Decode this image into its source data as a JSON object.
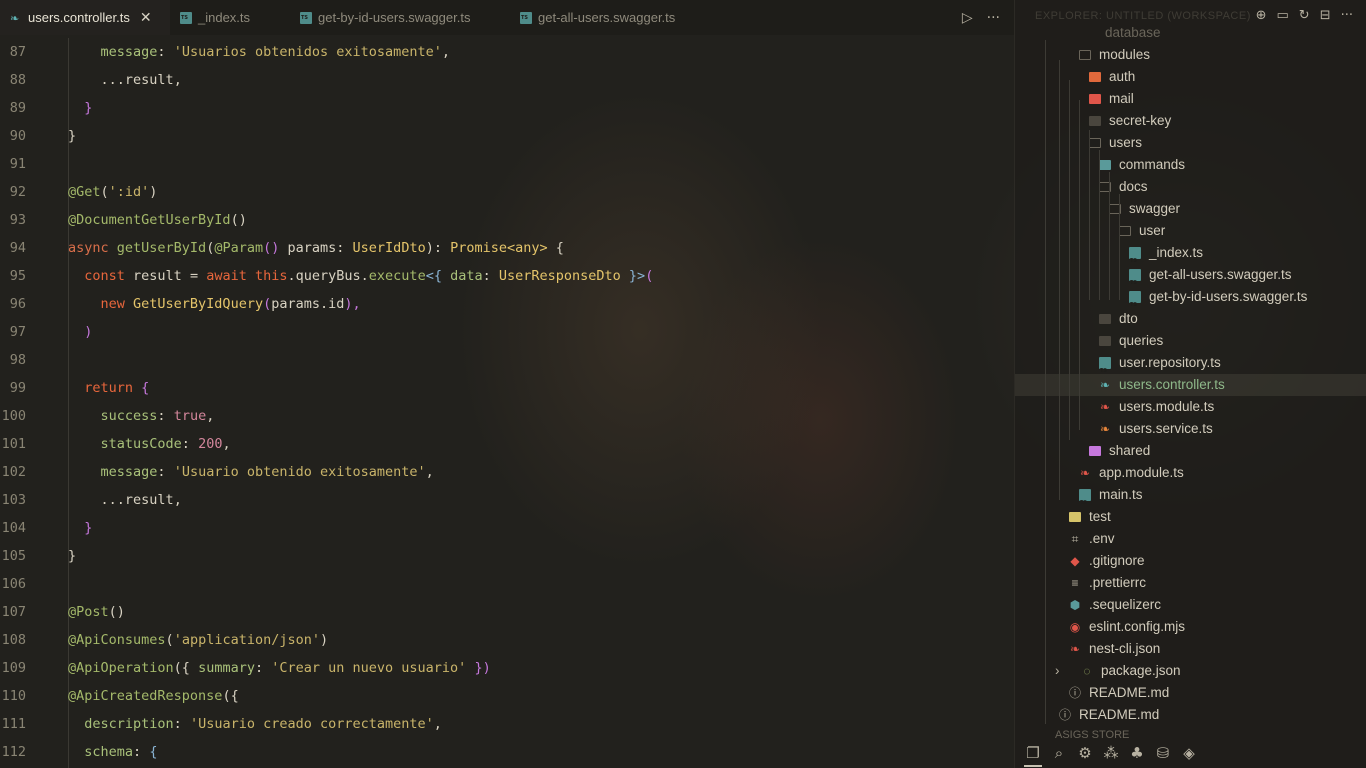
{
  "tabs": [
    {
      "label": "users.controller.ts",
      "icon": "nestjs-icon",
      "active": true
    },
    {
      "label": "_index.ts",
      "icon": "typescript-icon",
      "active": false
    },
    {
      "label": "get-by-id-users.swagger.ts",
      "icon": "typescript-icon",
      "active": false
    },
    {
      "label": "get-all-users.swagger.ts",
      "icon": "typescript-icon",
      "active": false
    }
  ],
  "tab_actions": {
    "run_icon": "▷",
    "more_icon": "···"
  },
  "code_lines": [
    {
      "n": "87",
      "tokens": [
        [
          "    ",
          "t-plain"
        ],
        [
          "message",
          "t-prop"
        ],
        [
          ": ",
          "t-plain"
        ],
        [
          "'Usuarios obtenidos exitosamente'",
          "t-str"
        ],
        [
          ",",
          "t-plain"
        ]
      ]
    },
    {
      "n": "88",
      "tokens": [
        [
          "    ...",
          "t-plain"
        ],
        [
          "result",
          "t-plain"
        ],
        [
          ",",
          "t-plain"
        ]
      ]
    },
    {
      "n": "89",
      "tokens": [
        [
          "  ",
          "t-plain"
        ],
        [
          "}",
          "t-paren"
        ]
      ]
    },
    {
      "n": "90",
      "tokens": [
        [
          "}",
          "t-brace"
        ]
      ]
    },
    {
      "n": "91",
      "tokens": []
    },
    {
      "n": "92",
      "tokens": [
        [
          "@Get",
          "t-dec"
        ],
        [
          "(",
          "t-brace"
        ],
        [
          "':id'",
          "t-str"
        ],
        [
          ")",
          "t-brace"
        ]
      ]
    },
    {
      "n": "93",
      "tokens": [
        [
          "@DocumentGetUserById",
          "t-dec"
        ],
        [
          "()",
          "t-brace"
        ]
      ]
    },
    {
      "n": "94",
      "tokens": [
        [
          "async ",
          "t-kw2"
        ],
        [
          "getUserById",
          "t-dec"
        ],
        [
          "(",
          "t-brace"
        ],
        [
          "@Param",
          "t-dec"
        ],
        [
          "() ",
          "t-paren"
        ],
        [
          "params",
          "t-plain"
        ],
        [
          ": ",
          "t-plain"
        ],
        [
          "UserIdDto",
          "t-type"
        ],
        [
          "): ",
          "t-brace"
        ],
        [
          "Promise",
          "t-type"
        ],
        [
          "<any>",
          "t-type"
        ],
        [
          " {",
          "t-brace"
        ]
      ]
    },
    {
      "n": "95",
      "tokens": [
        [
          "  ",
          "t-plain"
        ],
        [
          "const ",
          "t-kw"
        ],
        [
          "result ",
          "t-plain"
        ],
        [
          "= ",
          "t-plain"
        ],
        [
          "await ",
          "t-kw"
        ],
        [
          "this",
          "t-kw"
        ],
        [
          ".queryBus.",
          "t-plain"
        ],
        [
          "execute",
          "t-dec"
        ],
        [
          "<{ ",
          "t-gen"
        ],
        [
          "data",
          "t-prop"
        ],
        [
          ": ",
          "t-plain"
        ],
        [
          "UserResponseDto",
          "t-type"
        ],
        [
          " }>",
          "t-gen"
        ],
        [
          "(",
          "t-paren"
        ]
      ]
    },
    {
      "n": "96",
      "tokens": [
        [
          "    ",
          "t-plain"
        ],
        [
          "new ",
          "t-kw"
        ],
        [
          "GetUserByIdQuery",
          "t-type"
        ],
        [
          "(",
          "t-paren"
        ],
        [
          "params.id",
          "t-plain"
        ],
        [
          "),",
          "t-paren"
        ]
      ]
    },
    {
      "n": "97",
      "tokens": [
        [
          "  ",
          "t-plain"
        ],
        [
          ")",
          "t-paren"
        ]
      ]
    },
    {
      "n": "98",
      "tokens": []
    },
    {
      "n": "99",
      "tokens": [
        [
          "  ",
          "t-plain"
        ],
        [
          "return ",
          "t-kw"
        ],
        [
          "{",
          "t-paren"
        ]
      ]
    },
    {
      "n": "100",
      "tokens": [
        [
          "    ",
          "t-plain"
        ],
        [
          "success",
          "t-prop"
        ],
        [
          ": ",
          "t-plain"
        ],
        [
          "true",
          "t-bool"
        ],
        [
          ",",
          "t-plain"
        ]
      ]
    },
    {
      "n": "101",
      "tokens": [
        [
          "    ",
          "t-plain"
        ],
        [
          "statusCode",
          "t-prop"
        ],
        [
          ": ",
          "t-plain"
        ],
        [
          "200",
          "t-num"
        ],
        [
          ",",
          "t-plain"
        ]
      ]
    },
    {
      "n": "102",
      "tokens": [
        [
          "    ",
          "t-plain"
        ],
        [
          "message",
          "t-prop"
        ],
        [
          ": ",
          "t-plain"
        ],
        [
          "'Usuario obtenido exitosamente'",
          "t-str"
        ],
        [
          ",",
          "t-plain"
        ]
      ]
    },
    {
      "n": "103",
      "tokens": [
        [
          "    ...",
          "t-plain"
        ],
        [
          "result",
          "t-plain"
        ],
        [
          ",",
          "t-plain"
        ]
      ]
    },
    {
      "n": "104",
      "tokens": [
        [
          "  ",
          "t-plain"
        ],
        [
          "}",
          "t-paren"
        ]
      ]
    },
    {
      "n": "105",
      "tokens": [
        [
          "}",
          "t-brace"
        ]
      ]
    },
    {
      "n": "106",
      "tokens": []
    },
    {
      "n": "107",
      "tokens": [
        [
          "@Post",
          "t-dec"
        ],
        [
          "()",
          "t-brace"
        ]
      ]
    },
    {
      "n": "108",
      "tokens": [
        [
          "@ApiConsumes",
          "t-dec"
        ],
        [
          "(",
          "t-brace"
        ],
        [
          "'application/json'",
          "t-str"
        ],
        [
          ")",
          "t-brace"
        ]
      ]
    },
    {
      "n": "109",
      "tokens": [
        [
          "@ApiOperation",
          "t-dec"
        ],
        [
          "({ ",
          "t-brace"
        ],
        [
          "summary",
          "t-prop"
        ],
        [
          ": ",
          "t-plain"
        ],
        [
          "'Crear un nuevo usuario'",
          "t-str"
        ],
        [
          " })",
          "t-paren"
        ]
      ]
    },
    {
      "n": "110",
      "tokens": [
        [
          "@ApiCreatedResponse",
          "t-dec"
        ],
        [
          "({",
          "t-brace"
        ]
      ]
    },
    {
      "n": "111",
      "tokens": [
        [
          "  ",
          "t-plain"
        ],
        [
          "description",
          "t-prop"
        ],
        [
          ": ",
          "t-plain"
        ],
        [
          "'Usuario creado correctamente'",
          "t-str"
        ],
        [
          ",",
          "t-plain"
        ]
      ]
    },
    {
      "n": "112",
      "tokens": [
        [
          "  ",
          "t-plain"
        ],
        [
          "schema",
          "t-prop"
        ],
        [
          ": ",
          "t-plain"
        ],
        [
          "{",
          "t-gen"
        ]
      ]
    }
  ],
  "explorer": {
    "title": "EXPLORER: UNTITLED (WORKSPACE)",
    "top_partial": "database",
    "bottom_partial": "ASIGS STORE",
    "items": [
      {
        "label": "modules",
        "icon": "modules-folder-icon",
        "color": "#6aaa6a",
        "indent": 0,
        "open": true
      },
      {
        "label": "auth",
        "icon": "auth-folder-icon",
        "color": "#e0693c",
        "indent": 1
      },
      {
        "label": "mail",
        "icon": "mail-folder-icon",
        "color": "#e0564a",
        "indent": 1
      },
      {
        "label": "secret-key",
        "icon": "folder-icon",
        "color": "#4a463e",
        "indent": 1
      },
      {
        "label": "users",
        "icon": "folder-open-icon",
        "color": "#6a655a",
        "indent": 1,
        "open": true
      },
      {
        "label": "commands",
        "icon": "commands-folder-icon",
        "color": "#5a9a9a",
        "indent": 2
      },
      {
        "label": "docs",
        "icon": "docs-folder-icon",
        "color": "#6a655a",
        "indent": 2,
        "open": true
      },
      {
        "label": "swagger",
        "icon": "folder-open-icon",
        "color": "#6a655a",
        "indent": 3,
        "open": true
      },
      {
        "label": "user",
        "icon": "folder-open-icon",
        "color": "#6a655a",
        "indent": 4,
        "open": true
      },
      {
        "label": "_index.ts",
        "icon": "typescript-icon",
        "color": "#4f8c8a",
        "indent": 5
      },
      {
        "label": "get-all-users.swagger.ts",
        "icon": "typescript-icon",
        "color": "#4f8c8a",
        "indent": 5
      },
      {
        "label": "get-by-id-users.swagger.ts",
        "icon": "typescript-icon",
        "color": "#4f8c8a",
        "indent": 5
      },
      {
        "label": "dto",
        "icon": "folder-icon",
        "color": "#4a463e",
        "indent": 2
      },
      {
        "label": "queries",
        "icon": "folder-icon",
        "color": "#4a463e",
        "indent": 2
      },
      {
        "label": "user.repository.ts",
        "icon": "typescript-icon",
        "color": "#4f8c8a",
        "indent": 2
      },
      {
        "label": "users.controller.ts",
        "icon": "nestjs-icon",
        "color": "#5fb3b3",
        "indent": 2,
        "selected": true
      },
      {
        "label": "users.module.ts",
        "icon": "nestjs-icon",
        "color": "#e0564a",
        "indent": 2
      },
      {
        "label": "users.service.ts",
        "icon": "nestjs-icon",
        "color": "#e8863c",
        "indent": 2
      },
      {
        "label": "shared",
        "icon": "shared-folder-icon",
        "color": "#c678dd",
        "indent": 1
      },
      {
        "label": "app.module.ts",
        "icon": "nestjs-icon",
        "color": "#e0564a",
        "indent": 0
      },
      {
        "label": "main.ts",
        "icon": "typescript-icon",
        "color": "#4f8c8a",
        "indent": 0
      },
      {
        "label": "test",
        "icon": "test-folder-icon",
        "color": "#d6c46a",
        "indent": -1
      },
      {
        "label": ".env",
        "icon": "env-icon",
        "color": "#b8b2a2",
        "indent": -1
      },
      {
        "label": ".gitignore",
        "icon": "git-icon",
        "color": "#e0564a",
        "indent": -1
      },
      {
        "label": ".prettierrc",
        "icon": "prettier-icon",
        "color": "#b8b2a2",
        "indent": -1
      },
      {
        "label": ".sequelizerc",
        "icon": "sequelize-icon",
        "color": "#5a9a9a",
        "indent": -1
      },
      {
        "label": "eslint.config.mjs",
        "icon": "eslint-icon",
        "color": "#e0564a",
        "indent": -1
      },
      {
        "label": "nest-cli.json",
        "icon": "nestjs-icon",
        "color": "#e0564a",
        "indent": -1
      },
      {
        "label": "package.json",
        "icon": "npm-icon",
        "color": "#a4b96a",
        "indent": -1,
        "chevron": true
      },
      {
        "label": "README.md",
        "icon": "info-icon",
        "color": "#b8b2a2",
        "indent": -1
      },
      {
        "label": "README.md",
        "icon": "info-icon",
        "color": "#b8b2a2",
        "indent": -2
      }
    ]
  },
  "bottom_icons": [
    "files-icon",
    "search-icon",
    "source-control-icon",
    "extensions-icon",
    "tree-icon",
    "database-icon",
    "layers-icon"
  ]
}
